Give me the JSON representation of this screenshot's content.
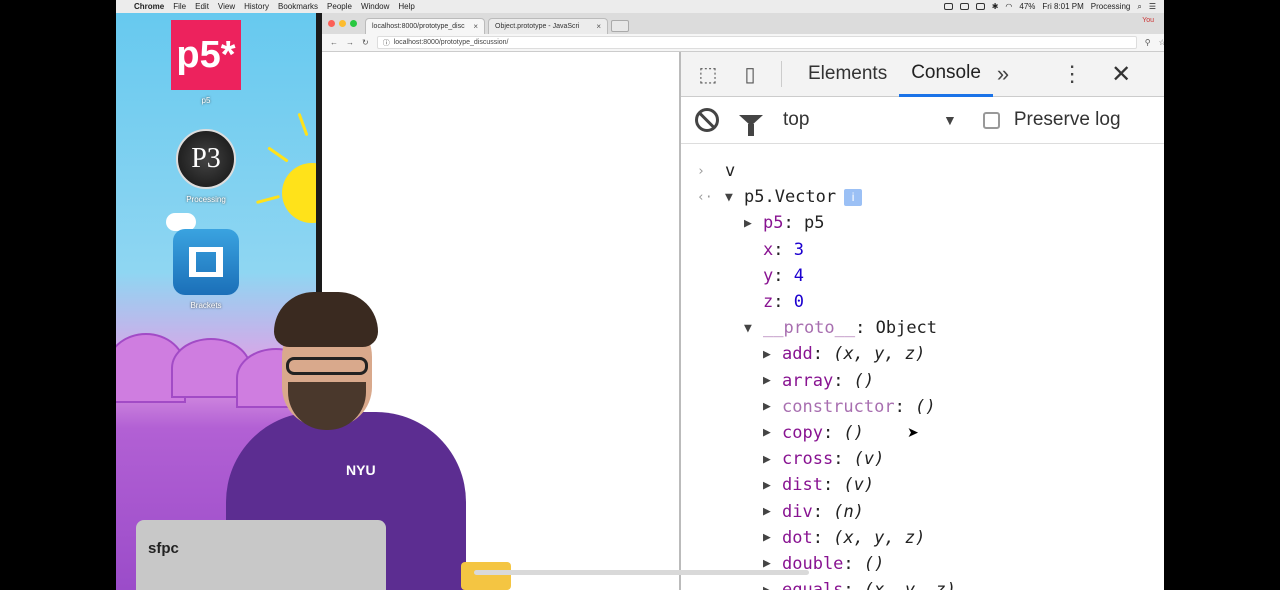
{
  "menubar": {
    "apple": "",
    "items": [
      "Chrome",
      "File",
      "Edit",
      "View",
      "History",
      "Bookmarks",
      "People",
      "Window",
      "Help"
    ],
    "battery": "47%",
    "clock": "Fri 8:01 PM",
    "app_right": "Processing"
  },
  "desktop": {
    "icons": [
      {
        "label": "p5",
        "logo_text": "p5*"
      },
      {
        "label": "Processing",
        "logo_text": "P3"
      },
      {
        "label": "Brackets",
        "logo_text": ""
      }
    ]
  },
  "browser": {
    "tabs": [
      {
        "title": "localhost:8000/prototype_disc",
        "active": true
      },
      {
        "title": "Object.prototype - JavaScri",
        "active": false
      }
    ],
    "user": "You",
    "url": "localhost:8000/prototype_discussion/"
  },
  "devtools": {
    "tabs": [
      "Elements",
      "Console"
    ],
    "active_tab": "Console",
    "more": "»",
    "context": "top",
    "preserve_log": "Preserve log",
    "input": "v",
    "object_name": "p5.Vector",
    "info_badge": "i",
    "p5_prop": {
      "key": "p5",
      "value": "p5"
    },
    "x": {
      "key": "x",
      "value": "3"
    },
    "y": {
      "key": "y",
      "value": "4"
    },
    "z": {
      "key": "z",
      "value": "0"
    },
    "proto": {
      "key": "__proto__",
      "value": "Object"
    },
    "methods": [
      {
        "name": "add",
        "sig": "(x, y, z)"
      },
      {
        "name": "array",
        "sig": "()"
      },
      {
        "name": "constructor",
        "sig": "()"
      },
      {
        "name": "copy",
        "sig": "()"
      },
      {
        "name": "cross",
        "sig": "(v)"
      },
      {
        "name": "dist",
        "sig": "(v)"
      },
      {
        "name": "div",
        "sig": "(n)"
      },
      {
        "name": "dot",
        "sig": "(x, y, z)"
      },
      {
        "name": "double",
        "sig": "()"
      },
      {
        "name": "equals",
        "sig": "(x, y, z)"
      }
    ]
  },
  "overlay": {
    "laptop_sticker": "sfpc",
    "hoodie_text": "NYU"
  },
  "colors": {
    "accent": "#1a73e8",
    "p5_pink": "#ed225d",
    "hoodie": "#5c2d91",
    "key_purple": "#881391",
    "number_blue": "#1c00cf"
  }
}
